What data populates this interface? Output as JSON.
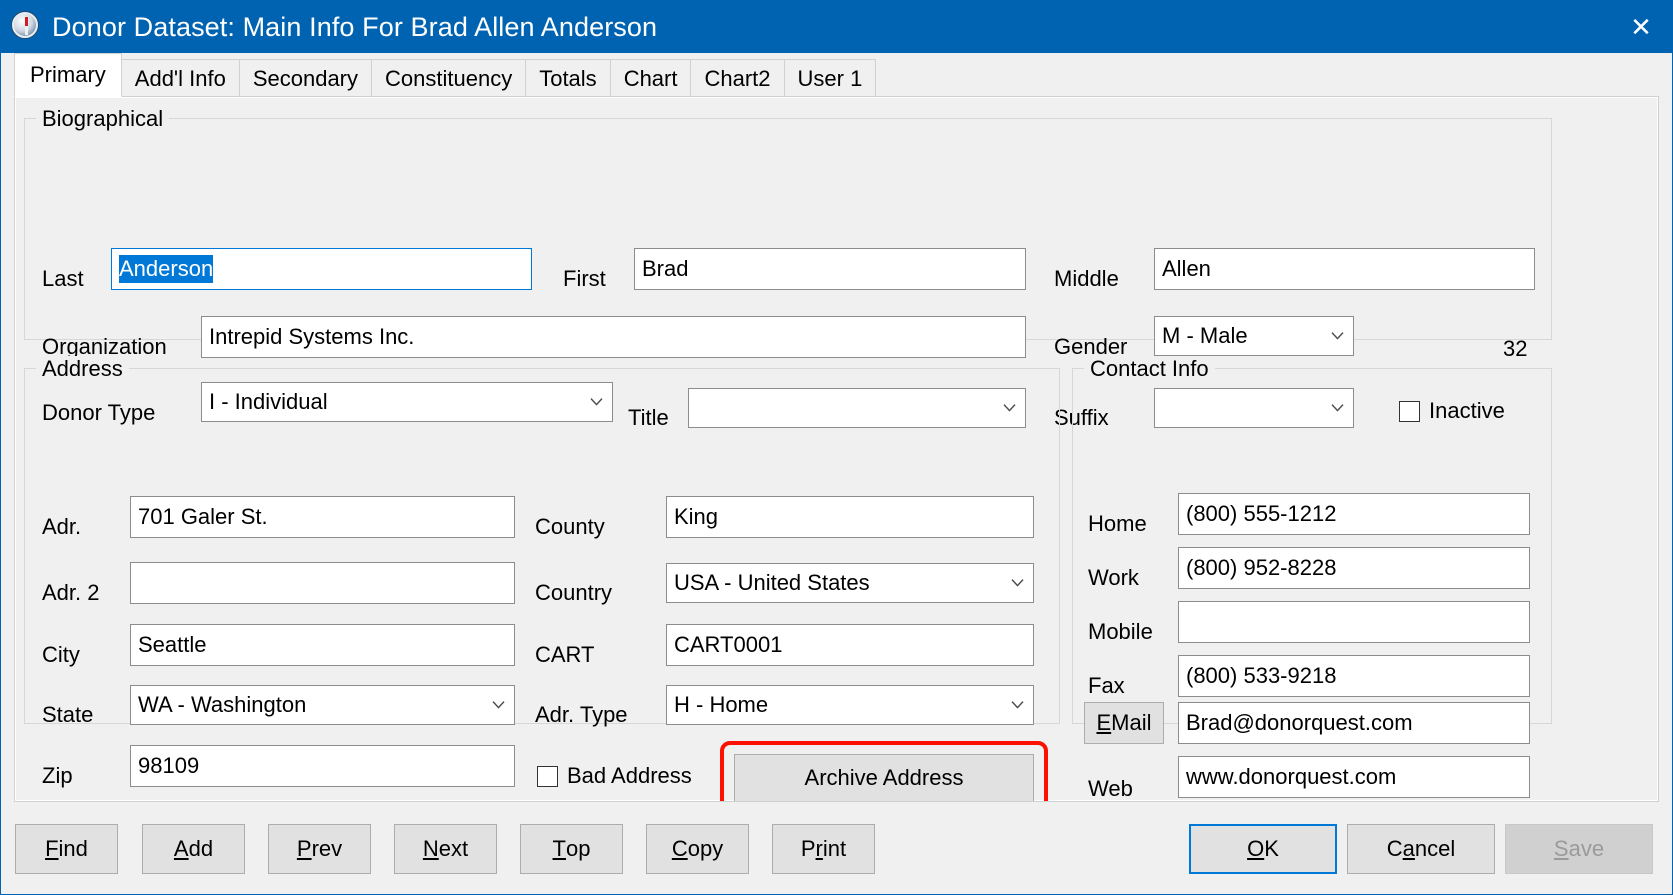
{
  "window": {
    "title": "Donor Dataset: Main Info For Brad Allen Anderson",
    "icon": "compass-icon",
    "close_label": "✕",
    "accent_color": "#0063b1",
    "highlight_color": "#fc1100",
    "selection_color": "#0078d7"
  },
  "tabs": [
    {
      "label": "Primary",
      "active": true
    },
    {
      "label": "Add'l Info",
      "active": false
    },
    {
      "label": "Secondary",
      "active": false
    },
    {
      "label": "Constituency",
      "active": false
    },
    {
      "label": "Totals",
      "active": false
    },
    {
      "label": "Chart",
      "active": false
    },
    {
      "label": "Chart2",
      "active": false
    },
    {
      "label": "User 1",
      "active": false
    }
  ],
  "biographical": {
    "group_title": "Biographical",
    "last_label": "Last",
    "last_value": "Anderson",
    "first_label": "First",
    "first_value": "Brad",
    "middle_label": "Middle",
    "middle_value": "Allen",
    "organization_label": "Organization",
    "organization_value": "Intrepid Systems Inc.",
    "gender_label": "Gender",
    "gender_value": "M - Male",
    "record_count": "32",
    "donor_type_label": "Donor Type",
    "donor_type_value": "I - Individual",
    "title_label": "Title",
    "title_value": "",
    "suffix_label": "Suffix",
    "suffix_value": "",
    "inactive_label": "Inactive",
    "inactive_checked": false
  },
  "address": {
    "group_title": "Address",
    "adr_label": "Adr.",
    "adr_value": "701 Galer St.",
    "adr2_label": "Adr. 2",
    "adr2_value": "",
    "city_label": "City",
    "city_value": "Seattle",
    "state_label": "State",
    "state_value": "WA - Washington",
    "zip_label": "Zip",
    "zip_value": "98109",
    "county_label": "County",
    "county_value": "King",
    "country_label": "Country",
    "country_value": "USA - United States",
    "cart_label": "CART",
    "cart_value": "CART0001",
    "adr_type_label": "Adr. Type",
    "adr_type_value": "H - Home",
    "bad_address_label": "Bad Address",
    "bad_address_checked": false,
    "archive_address_label": "Archive Address"
  },
  "contact": {
    "group_title": "Contact Info",
    "home_label": "Home",
    "home_value": "(800) 555-1212",
    "work_label": "Work",
    "work_value": "(800) 952-8228",
    "mobile_label": "Mobile",
    "mobile_value": "",
    "fax_label": "Fax",
    "fax_value": "(800) 533-9218",
    "email_label_pre": "E",
    "email_label_post": "Mail",
    "email_value": "Brad@donorquest.com",
    "web_label": "Web",
    "web_value": "www.donorquest.com"
  },
  "buttons": {
    "find": {
      "acc": "F",
      "rest": "ind"
    },
    "add": {
      "acc": "A",
      "rest": "dd"
    },
    "prev": {
      "acc": "P",
      "rest": "rev"
    },
    "next": {
      "acc": "N",
      "rest": "ext"
    },
    "top": {
      "acc": "T",
      "rest": "op"
    },
    "copy": {
      "acc": "C",
      "rest": "opy"
    },
    "print": {
      "pre": "P",
      "acc": "r",
      "rest": "int"
    },
    "ok": {
      "acc": "O",
      "rest": "K"
    },
    "cancel": {
      "pre": "C",
      "acc": "a",
      "rest": "ncel"
    },
    "save": {
      "acc": "S",
      "rest": "ave",
      "disabled": true
    }
  }
}
